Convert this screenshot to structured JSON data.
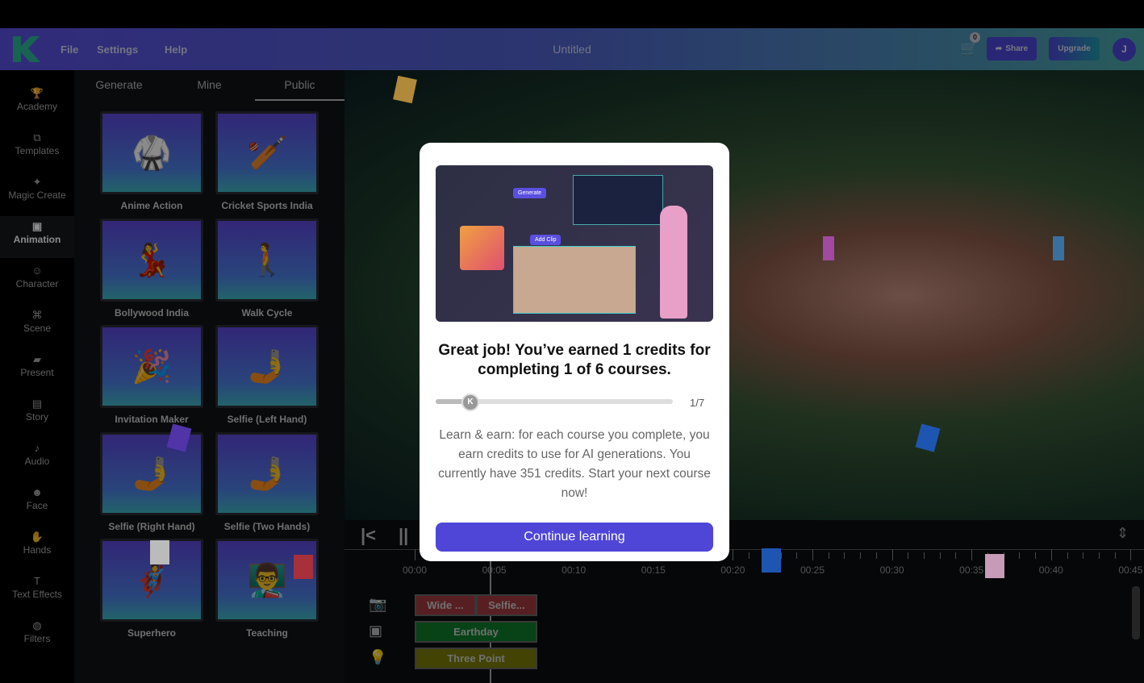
{
  "header": {
    "menu": [
      "File",
      "Settings",
      "Help"
    ],
    "title": "Untitled",
    "cart_count": "0",
    "share": "Share",
    "upgrade": "Upgrade",
    "avatar": "J"
  },
  "sidebar": {
    "items": [
      {
        "label": "Academy",
        "icon": "trophy-icon",
        "glyph": "🏆"
      },
      {
        "label": "Templates",
        "icon": "templates-icon",
        "glyph": "⧉"
      },
      {
        "label": "Magic Create",
        "icon": "magic-wand-icon",
        "glyph": "✦"
      },
      {
        "label": "Animation",
        "icon": "animation-icon",
        "glyph": "▣"
      },
      {
        "label": "Character",
        "icon": "character-icon",
        "glyph": "☺"
      },
      {
        "label": "Scene",
        "icon": "scene-icon",
        "glyph": "⌘"
      },
      {
        "label": "Present",
        "icon": "present-icon",
        "glyph": "▰"
      },
      {
        "label": "Story",
        "icon": "story-icon",
        "glyph": "▤"
      },
      {
        "label": "Audio",
        "icon": "microphone-icon",
        "glyph": "♪"
      },
      {
        "label": "Face",
        "icon": "face-icon",
        "glyph": "☻"
      },
      {
        "label": "Hands",
        "icon": "hand-icon",
        "glyph": "✋"
      },
      {
        "label": "Text Effects",
        "icon": "text-icon",
        "glyph": "T"
      },
      {
        "label": "Filters",
        "icon": "palette-icon",
        "glyph": "◍"
      }
    ],
    "active": "Animation"
  },
  "panel": {
    "tabs": [
      "Generate",
      "Mine",
      "Public"
    ],
    "active_tab": "Public",
    "cards": [
      "Anime Action",
      "Cricket Sports India",
      "Bollywood India",
      "Walk Cycle",
      "Invitation Maker",
      "Selfie (Left Hand)",
      "Selfie (Right Hand)",
      "Selfie (Two Hands)",
      "Superhero",
      "Teaching"
    ]
  },
  "timeline": {
    "labels": [
      "00:00",
      "00:05",
      "00:10",
      "00:15",
      "00:20",
      "00:25",
      "00:30",
      "00:35",
      "00:40",
      "00:45"
    ],
    "tracks": [
      {
        "icon": "camera-icon",
        "clips": [
          "Wide ...",
          "Selfie..."
        ],
        "color": "#a03a3e"
      },
      {
        "icon": "scene-icon",
        "clips": [
          "Earthday"
        ],
        "color": "#0e7a2a"
      },
      {
        "icon": "light-bulb-icon",
        "clips": [
          "Three Point"
        ],
        "color": "#7a7a08"
      }
    ]
  },
  "modal": {
    "image_labels": [
      "Generate",
      "Add Clip"
    ],
    "title": "Great job! You’ve earned 1 credits for completing 1 of 6 courses.",
    "progress": "1/7",
    "progress_fraction": 0.14,
    "body": "Learn & earn: for each course you complete, you earn credits to use for AI generations. You currently have 351 credits. Start your next course now!",
    "button": "Continue learning"
  },
  "colors": {
    "accent": "#4f46d8"
  }
}
